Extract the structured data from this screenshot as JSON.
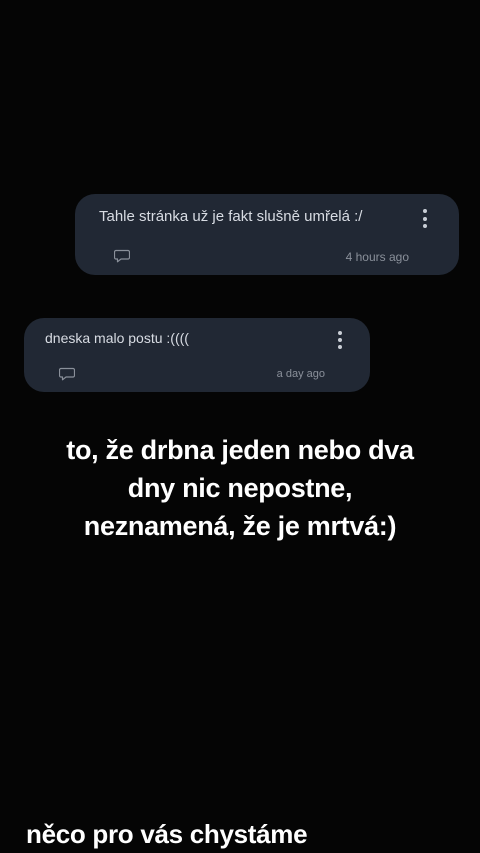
{
  "messages": [
    {
      "text": "Tahle stránka už je fakt slušně umřelá :/",
      "time": "4 hours ago",
      "icons": [
        "comment-icon",
        "more-vertical-icon"
      ]
    },
    {
      "text": "dneska malo postu :((((",
      "time": "a day ago",
      "icons": [
        "comment-icon",
        "more-vertical-icon"
      ]
    }
  ],
  "caption": {
    "lines": [
      "to, že drbna jeden nebo dva",
      "dny nic nepostne,",
      "neznamená, že je mrtvá:)"
    ]
  },
  "footer_caption": "něco pro vás chystáme",
  "colors": {
    "background": "#050505",
    "bubble": "#212834",
    "text": "#d8dce3",
    "timestamp": "#8a909a",
    "caption": "#ffffff"
  }
}
